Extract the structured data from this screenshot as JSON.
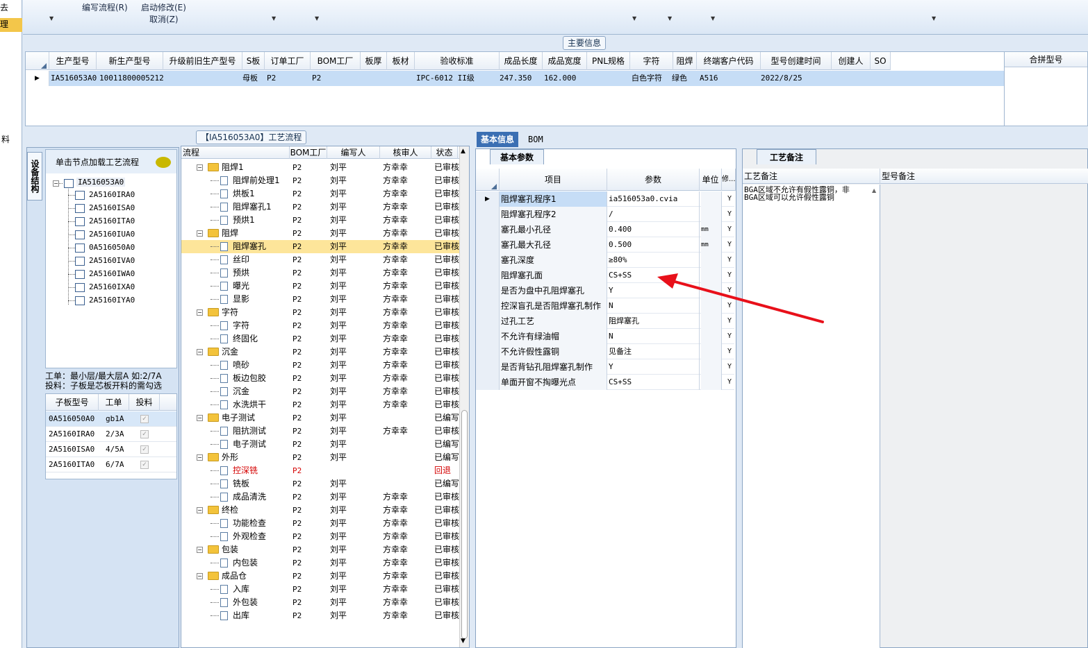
{
  "left_strip": {
    "items": [
      "去",
      "理",
      "料"
    ]
  },
  "ribbon": {
    "edit_flow": "编写流程(R)",
    "start_modify": "启动修改(E)",
    "cancel": "取消(Z)"
  },
  "main_info": {
    "title": "主要信息",
    "columns": [
      "生产型号",
      "新生产型号",
      "升级前旧生产型号",
      "S板",
      "订单工厂",
      "BOM工厂",
      "板厚",
      "板材",
      "验收标准",
      "成品长度",
      "成品宽度",
      "PNL规格",
      "字符",
      "阻焊",
      "终端客户代码",
      "型号创建时间",
      "创建人",
      "SO"
    ],
    "row": [
      "IA516053A0",
      "10011800005212",
      "",
      "母板",
      "P2",
      "P2",
      "",
      "",
      "IPC-6012 II级",
      "247.350",
      "162.000",
      "",
      "白色字符",
      "绿色",
      "A516",
      "2022/8/25",
      "",
      ""
    ],
    "merge_col": "合拼型号"
  },
  "flow_panel_title": "【IA516053A0】工艺流程",
  "tree_panel": {
    "vtab": "设备结构",
    "hint": "单击节点加载工艺流程",
    "root": "IA516053A0",
    "children": [
      "2A5160IRA0",
      "2A5160ISA0",
      "2A5160ITA0",
      "2A5160IUA0",
      "0A516050A0",
      "2A5160IVA0",
      "2A5160IWA0",
      "2A5160IXA0",
      "2A5160IYA0"
    ],
    "note1": "工单：最小层/最大层A 如:2/7A",
    "note2": "投料：子板是芯板开料的需勾选",
    "sub_cols": [
      "子板型号",
      "工单",
      "投料"
    ],
    "sub_rows": [
      [
        "0A516050A0",
        "gb1A"
      ],
      [
        "2A5160IRA0",
        "2/3A"
      ],
      [
        "2A5160ISA0",
        "4/5A"
      ],
      [
        "2A5160ITA0",
        "6/7A"
      ]
    ]
  },
  "flow": {
    "columns": [
      "流程",
      "BOM工厂",
      "编写人",
      "核审人",
      "状态"
    ],
    "rows": [
      {
        "name": "阻焊1",
        "type": "folder",
        "bom": "P2",
        "writer": "刘平",
        "reviewer": "方幸幸",
        "status": "已审核"
      },
      {
        "name": "阻焊前处理1",
        "type": "doc",
        "bom": "P2",
        "writer": "刘平",
        "reviewer": "方幸幸",
        "status": "已审核"
      },
      {
        "name": "烘板1",
        "type": "doc",
        "bom": "P2",
        "writer": "刘平",
        "reviewer": "方幸幸",
        "status": "已审核"
      },
      {
        "name": "阻焊塞孔1",
        "type": "doc",
        "bom": "P2",
        "writer": "刘平",
        "reviewer": "方幸幸",
        "status": "已审核"
      },
      {
        "name": "预烘1",
        "type": "doc",
        "bom": "P2",
        "writer": "刘平",
        "reviewer": "方幸幸",
        "status": "已审核"
      },
      {
        "name": "阻焊",
        "type": "folder",
        "bom": "P2",
        "writer": "刘平",
        "reviewer": "方幸幸",
        "status": "已审核"
      },
      {
        "name": "阻焊塞孔",
        "type": "doc",
        "bom": "P2",
        "writer": "刘平",
        "reviewer": "方幸幸",
        "status": "已审核",
        "selected": true
      },
      {
        "name": "丝印",
        "type": "doc",
        "bom": "P2",
        "writer": "刘平",
        "reviewer": "方幸幸",
        "status": "已审核"
      },
      {
        "name": "预烘",
        "type": "doc",
        "bom": "P2",
        "writer": "刘平",
        "reviewer": "方幸幸",
        "status": "已审核"
      },
      {
        "name": "曝光",
        "type": "doc",
        "bom": "P2",
        "writer": "刘平",
        "reviewer": "方幸幸",
        "status": "已审核"
      },
      {
        "name": "显影",
        "type": "doc",
        "bom": "P2",
        "writer": "刘平",
        "reviewer": "方幸幸",
        "status": "已审核"
      },
      {
        "name": "字符",
        "type": "folder",
        "bom": "P2",
        "writer": "刘平",
        "reviewer": "方幸幸",
        "status": "已审核"
      },
      {
        "name": "字符",
        "type": "doc",
        "bom": "P2",
        "writer": "刘平",
        "reviewer": "方幸幸",
        "status": "已审核"
      },
      {
        "name": "终固化",
        "type": "doc",
        "bom": "P2",
        "writer": "刘平",
        "reviewer": "方幸幸",
        "status": "已审核"
      },
      {
        "name": "沉金",
        "type": "folder",
        "bom": "P2",
        "writer": "刘平",
        "reviewer": "方幸幸",
        "status": "已审核"
      },
      {
        "name": "喷砂",
        "type": "doc",
        "bom": "P2",
        "writer": "刘平",
        "reviewer": "方幸幸",
        "status": "已审核"
      },
      {
        "name": "板边包胶",
        "type": "doc",
        "bom": "P2",
        "writer": "刘平",
        "reviewer": "方幸幸",
        "status": "已审核"
      },
      {
        "name": "沉金",
        "type": "doc",
        "bom": "P2",
        "writer": "刘平",
        "reviewer": "方幸幸",
        "status": "已审核"
      },
      {
        "name": "水洗烘干",
        "type": "doc",
        "bom": "P2",
        "writer": "刘平",
        "reviewer": "方幸幸",
        "status": "已审核"
      },
      {
        "name": "电子测试",
        "type": "folder",
        "bom": "P2",
        "writer": "刘平",
        "reviewer": "",
        "status": "已编写"
      },
      {
        "name": "阻抗测试",
        "type": "doc",
        "bom": "P2",
        "writer": "刘平",
        "reviewer": "方幸幸",
        "status": "已审核"
      },
      {
        "name": "电子测试",
        "type": "doc",
        "bom": "P2",
        "writer": "刘平",
        "reviewer": "",
        "status": "已编写"
      },
      {
        "name": "外形",
        "type": "folder",
        "bom": "P2",
        "writer": "刘平",
        "reviewer": "",
        "status": "已编写"
      },
      {
        "name": "控深铣",
        "type": "doc",
        "bom": "P2",
        "writer": "",
        "reviewer": "",
        "status": "回退",
        "red": true
      },
      {
        "name": "铣板",
        "type": "doc",
        "bom": "P2",
        "writer": "刘平",
        "reviewer": "",
        "status": "已编写"
      },
      {
        "name": "成品清洗",
        "type": "doc",
        "bom": "P2",
        "writer": "刘平",
        "reviewer": "方幸幸",
        "status": "已审核"
      },
      {
        "name": "终检",
        "type": "folder",
        "bom": "P2",
        "writer": "刘平",
        "reviewer": "方幸幸",
        "status": "已审核"
      },
      {
        "name": "功能检查",
        "type": "doc",
        "bom": "P2",
        "writer": "刘平",
        "reviewer": "方幸幸",
        "status": "已审核"
      },
      {
        "name": "外观检查",
        "type": "doc",
        "bom": "P2",
        "writer": "刘平",
        "reviewer": "方幸幸",
        "status": "已审核"
      },
      {
        "name": "包装",
        "type": "folder",
        "bom": "P2",
        "writer": "刘平",
        "reviewer": "方幸幸",
        "status": "已审核"
      },
      {
        "name": "内包装",
        "type": "doc",
        "bom": "P2",
        "writer": "刘平",
        "reviewer": "方幸幸",
        "status": "已审核"
      },
      {
        "name": "成品仓",
        "type": "folder",
        "bom": "P2",
        "writer": "刘平",
        "reviewer": "方幸幸",
        "status": "已审核"
      },
      {
        "name": "入库",
        "type": "doc",
        "bom": "P2",
        "writer": "刘平",
        "reviewer": "方幸幸",
        "status": "已审核"
      },
      {
        "name": "外包装",
        "type": "doc",
        "bom": "P2",
        "writer": "刘平",
        "reviewer": "方幸幸",
        "status": "已审核"
      },
      {
        "name": "出库",
        "type": "doc",
        "bom": "P2",
        "writer": "刘平",
        "reviewer": "方幸幸",
        "status": "已审核"
      }
    ]
  },
  "info": {
    "tabs": [
      "基本信息",
      "BOM"
    ],
    "sub_tab": "基本参数",
    "param_cols": [
      "项目",
      "参数",
      "单位",
      "修..."
    ],
    "params": [
      [
        "阻焊塞孔程序1",
        "ia516053a0.cvia",
        "",
        "Y"
      ],
      [
        "阻焊塞孔程序2",
        "/",
        "",
        "Y"
      ],
      [
        "塞孔最小孔径",
        "0.400",
        "mm",
        "Y"
      ],
      [
        "塞孔最大孔径",
        "0.500",
        "mm",
        "Y"
      ],
      [
        "塞孔深度",
        "≥80%",
        "",
        "Y"
      ],
      [
        "阻焊塞孔面",
        "CS+SS",
        "",
        "Y"
      ],
      [
        "是否为盘中孔阻焊塞孔",
        "Y",
        "",
        "Y"
      ],
      [
        "控深盲孔是否阻焊塞孔制作",
        "N",
        "",
        "Y"
      ],
      [
        "过孔工艺",
        "阻焊塞孔",
        "",
        "Y"
      ],
      [
        "不允许有绿油帽",
        "N",
        "",
        "Y"
      ],
      [
        "不允许假性露铜",
        "见备注",
        "",
        "Y"
      ],
      [
        "是否背钻孔阻焊塞孔制作",
        "Y",
        "",
        "Y"
      ],
      [
        "单面开窗不掏曝光点",
        "CS+SS",
        "",
        "Y"
      ]
    ],
    "remark_tab": "工艺备注",
    "remark_cols": [
      "工艺备注",
      "型号备注"
    ],
    "remark_text1": "BGA区域不允许有假性露铜，非",
    "remark_text2": "BGA区域可以允许假性露铜",
    "arrow_color": "#e8101a"
  }
}
